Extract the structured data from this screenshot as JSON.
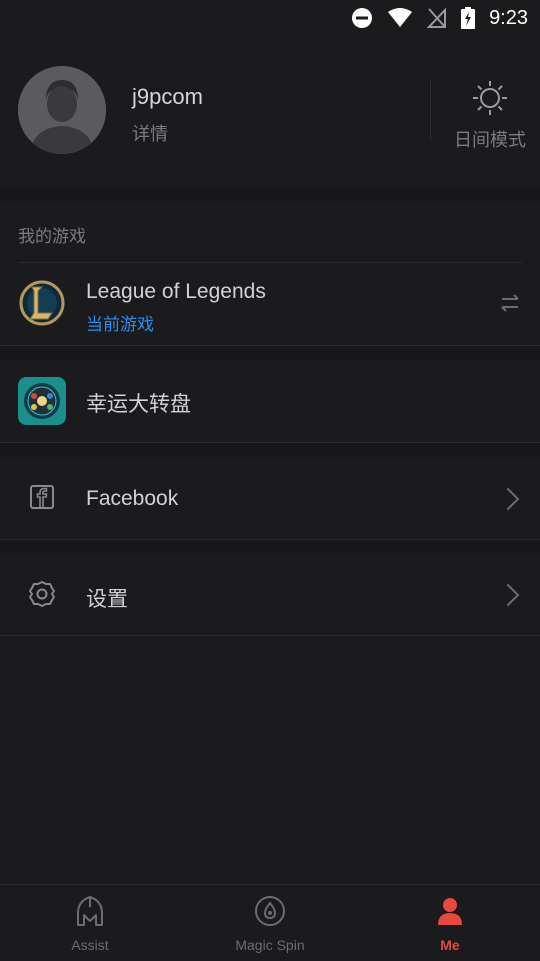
{
  "status_bar": {
    "time": "9:23",
    "icons": [
      "do-not-disturb-icon",
      "wifi-icon",
      "no-signal-icon",
      "battery-charging-icon"
    ]
  },
  "profile": {
    "username": "j9pcom",
    "details_label": "详情",
    "daymode_label": "日间模式",
    "daymode_icon": "sun-icon"
  },
  "my_games": {
    "section_title": "我的游戏",
    "current_game": {
      "name": "League of Legends",
      "subtitle": "当前游戏",
      "icon": "league-of-legends-logo",
      "action_icon": "swap-icon"
    }
  },
  "lucky_wheel": {
    "label": "幸运大转盘",
    "icon": "lucky-wheel-app-icon"
  },
  "facebook": {
    "label": "Facebook",
    "icon": "facebook-icon"
  },
  "settings": {
    "label": "设置",
    "icon": "settings-gear-icon"
  },
  "tabs": [
    {
      "label": "Assist",
      "icon": "helmet-icon",
      "active": false
    },
    {
      "label": "Magic Spin",
      "icon": "magic-spin-icon",
      "active": false
    },
    {
      "label": "Me",
      "icon": "person-icon",
      "active": true
    }
  ],
  "colors": {
    "background": "#1b1b1d",
    "accent_blue": "#2b8df0",
    "active_red": "#e7483f"
  }
}
